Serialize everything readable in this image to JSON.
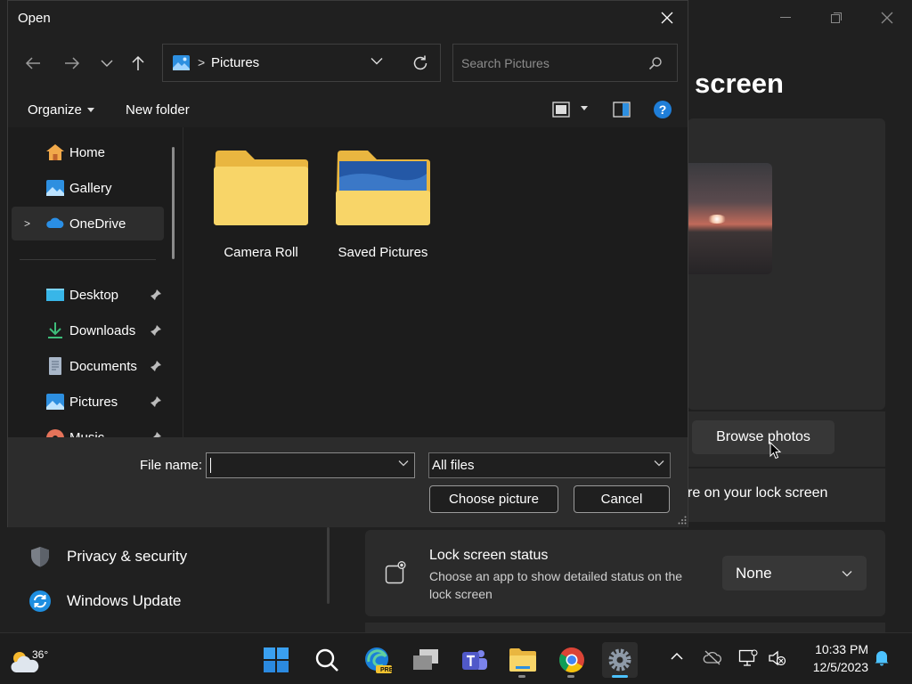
{
  "background_window": {
    "page_title": "screen",
    "browse_button": "Browse photos",
    "lock_apps_text": "re on your lock screen",
    "lock_status": {
      "title": "Lock screen status",
      "description": "Choose an app to show detailed status on the lock screen",
      "dropdown_value": "None"
    },
    "nav": [
      {
        "label": "Privacy & security",
        "icon": "shield-icon"
      },
      {
        "label": "Windows Update",
        "icon": "windows-update-icon"
      }
    ]
  },
  "dialog": {
    "title": "Open",
    "address": {
      "separator": ">",
      "path": "Pictures"
    },
    "search_placeholder": "Search Pictures",
    "toolbar": {
      "organize": "Organize",
      "new_folder": "New folder",
      "help": "?"
    },
    "nav_items": [
      {
        "label": "Home",
        "icon": "home-icon"
      },
      {
        "label": "Gallery",
        "icon": "gallery-icon"
      },
      {
        "label": "OneDrive",
        "icon": "onedrive-icon",
        "selected": true,
        "expander": ">"
      },
      {
        "label": "Desktop",
        "icon": "desktop-icon",
        "pinned": true
      },
      {
        "label": "Downloads",
        "icon": "downloads-icon",
        "pinned": true
      },
      {
        "label": "Documents",
        "icon": "documents-icon",
        "pinned": true
      },
      {
        "label": "Pictures",
        "icon": "pictures-icon",
        "pinned": true
      },
      {
        "label": "Music",
        "icon": "music-icon",
        "pinned": true
      }
    ],
    "folders": [
      {
        "label": "Camera Roll"
      },
      {
        "label": "Saved Pictures"
      }
    ],
    "file_name_label": "File name:",
    "file_name_value": "",
    "file_type": "All files",
    "choose_button": "Choose picture",
    "cancel_button": "Cancel"
  },
  "taskbar": {
    "weather_temp": "36°",
    "apps": [
      "start-icon",
      "search-icon",
      "edge-preview-icon",
      "task-view-icon",
      "teams-icon",
      "file-explorer-icon",
      "chrome-icon",
      "settings-icon"
    ],
    "edge_badge": "PRE",
    "clock_time": "10:33 PM",
    "clock_date": "12/5/2023"
  },
  "colors": {
    "accent": "#1f7ed8",
    "folder_yellow": "#f7cf5a",
    "dialog_bg": "#1c1c1c",
    "bottom_bar": "#2c2c2c"
  }
}
